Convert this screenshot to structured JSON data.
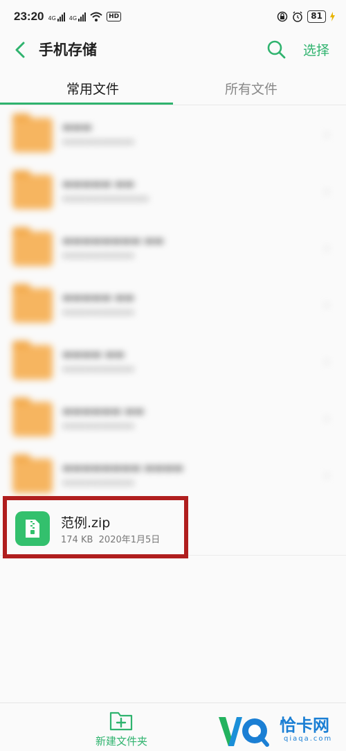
{
  "status_bar": {
    "time": "23:20",
    "sim1": "4G",
    "sim2": "4G",
    "hd": "HD",
    "battery": "81"
  },
  "header": {
    "title": "手机存储",
    "select_label": "选择"
  },
  "tabs": [
    {
      "label": "常用文件",
      "active": true
    },
    {
      "label": "所有文件",
      "active": false
    }
  ],
  "file": {
    "name": "范例.zip",
    "size": "174 KB",
    "date": "2020年1月5日"
  },
  "bottom_bar": {
    "new_folder_label": "新建文件夹"
  },
  "watermark": {
    "text": "恰卡网",
    "sub": "qiaqa.com"
  },
  "colors": {
    "accent": "#2fb36e",
    "highlight": "#b01e1e",
    "folder": "#f6b560"
  }
}
